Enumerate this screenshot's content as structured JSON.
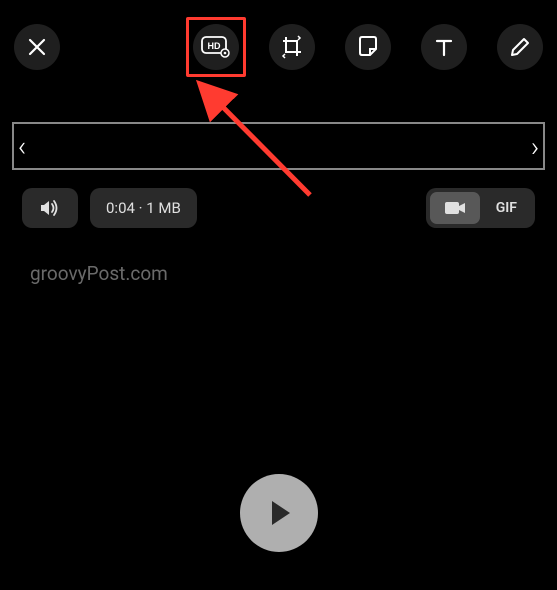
{
  "toolbar": {
    "close_label": "Close",
    "hd_label": "HD",
    "crop_label": "Crop",
    "sticker_label": "Sticker",
    "text_label": "Text",
    "draw_label": "Draw"
  },
  "trim": {
    "left_handle": "‹",
    "right_handle": "›"
  },
  "controls": {
    "sound_label": "Sound",
    "info_text": "0:04 · 1 MB",
    "video_label": "Video",
    "gif_label": "GIF"
  },
  "watermark": "groovyPost.com",
  "play_label": "Play",
  "annotation": {
    "highlight_color": "#ff3b30",
    "arrow_color": "#ff3b30"
  }
}
